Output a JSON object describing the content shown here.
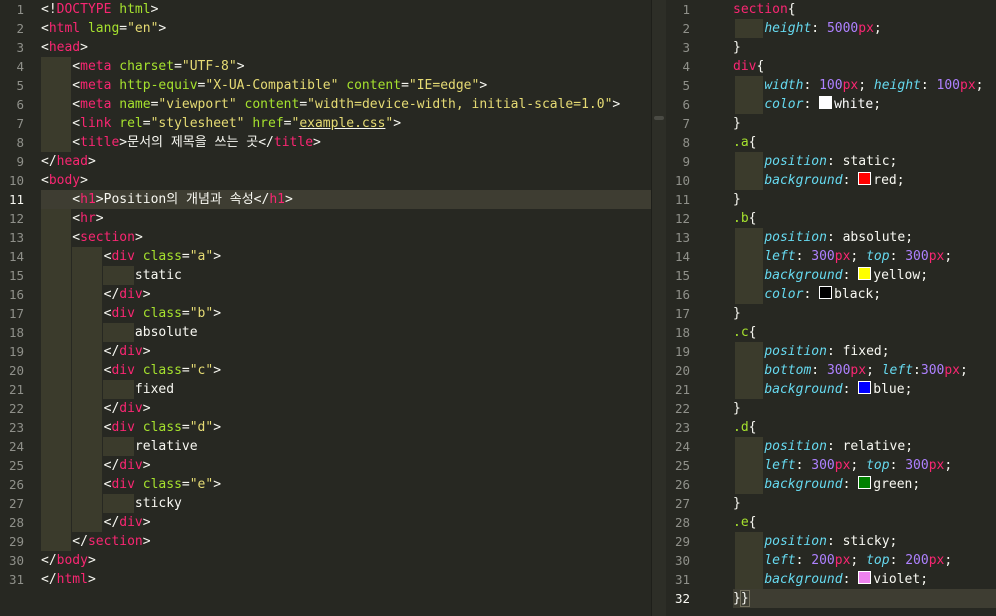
{
  "colors": {
    "tag": "#f92672",
    "attr": "#a6e22e",
    "string": "#e6db74",
    "text": "#f8f8f2",
    "prop": "#66d9ef",
    "number": "#ae81ff",
    "punct": "#f8f8f2"
  },
  "left": {
    "lines": [
      [
        [
          "<!",
          "#f8f8f2"
        ],
        [
          "DOCTYPE",
          "#f92672"
        ],
        [
          " html",
          "#a6e22e"
        ],
        [
          ">",
          "#f8f8f2"
        ]
      ],
      [
        [
          "<",
          "#f8f8f2"
        ],
        [
          "html",
          "#f92672"
        ],
        [
          " lang",
          "#a6e22e"
        ],
        [
          "=",
          "#f8f8f2"
        ],
        [
          "\"en\"",
          "#e6db74"
        ],
        [
          ">",
          "#f8f8f2"
        ]
      ],
      [
        [
          "<",
          "#f8f8f2"
        ],
        [
          "head",
          "#f92672"
        ],
        [
          ">",
          "#f8f8f2"
        ]
      ],
      [
        [
          "    <",
          "#f8f8f2"
        ],
        [
          "meta",
          "#f92672"
        ],
        [
          " charset",
          "#a6e22e"
        ],
        [
          "=",
          "#f8f8f2"
        ],
        [
          "\"UTF-8\"",
          "#e6db74"
        ],
        [
          ">",
          "#f8f8f2"
        ]
      ],
      [
        [
          "    <",
          "#f8f8f2"
        ],
        [
          "meta",
          "#f92672"
        ],
        [
          " http-equiv",
          "#a6e22e"
        ],
        [
          "=",
          "#f8f8f2"
        ],
        [
          "\"X-UA-Compatible\"",
          "#e6db74"
        ],
        [
          " content",
          "#a6e22e"
        ],
        [
          "=",
          "#f8f8f2"
        ],
        [
          "\"IE=edge\"",
          "#e6db74"
        ],
        [
          ">",
          "#f8f8f2"
        ]
      ],
      [
        [
          "    <",
          "#f8f8f2"
        ],
        [
          "meta",
          "#f92672"
        ],
        [
          " name",
          "#a6e22e"
        ],
        [
          "=",
          "#f8f8f2"
        ],
        [
          "\"viewport\"",
          "#e6db74"
        ],
        [
          " content",
          "#a6e22e"
        ],
        [
          "=",
          "#f8f8f2"
        ],
        [
          "\"width=device-width, initial-scale=1.0\"",
          "#e6db74"
        ],
        [
          ">",
          "#f8f8f2"
        ]
      ],
      [
        [
          "    <",
          "#f8f8f2"
        ],
        [
          "link",
          "#f92672"
        ],
        [
          " rel",
          "#a6e22e"
        ],
        [
          "=",
          "#f8f8f2"
        ],
        [
          "\"stylesheet\"",
          "#e6db74"
        ],
        [
          " href",
          "#a6e22e"
        ],
        [
          "=",
          "#f8f8f2"
        ],
        [
          "\"",
          "#e6db74"
        ],
        [
          "example.css",
          "#e6db74",
          "u"
        ],
        [
          "\"",
          "#e6db74"
        ],
        [
          ">",
          "#f8f8f2"
        ]
      ],
      [
        [
          "    <",
          "#f8f8f2"
        ],
        [
          "title",
          "#f92672"
        ],
        [
          ">문서의 제목을 쓰는 곳</",
          "#f8f8f2"
        ],
        [
          "title",
          "#f92672"
        ],
        [
          ">",
          "#f8f8f2"
        ]
      ],
      [
        [
          "</",
          "#f8f8f2"
        ],
        [
          "head",
          "#f92672"
        ],
        [
          ">",
          "#f8f8f2"
        ]
      ],
      [
        [
          "<",
          "#f8f8f2"
        ],
        [
          "body",
          "#f92672"
        ],
        [
          ">",
          "#f8f8f2"
        ]
      ],
      [
        [
          "    <",
          "#f8f8f2"
        ],
        [
          "h1",
          "#f92672"
        ],
        [
          ">Position의 개념과 속성</",
          "#f8f8f2"
        ],
        [
          "h1",
          "#f92672"
        ],
        [
          ">",
          "#f8f8f2"
        ]
      ],
      [
        [
          "    <",
          "#f8f8f2"
        ],
        [
          "hr",
          "#f92672"
        ],
        [
          ">",
          "#f8f8f2"
        ]
      ],
      [
        [
          "    <",
          "#f8f8f2"
        ],
        [
          "section",
          "#f92672"
        ],
        [
          ">",
          "#f8f8f2"
        ]
      ],
      [
        [
          "        <",
          "#f8f8f2"
        ],
        [
          "div",
          "#f92672"
        ],
        [
          " class",
          "#a6e22e"
        ],
        [
          "=",
          "#f8f8f2"
        ],
        [
          "\"a\"",
          "#e6db74"
        ],
        [
          ">",
          "#f8f8f2"
        ]
      ],
      [
        [
          "            static",
          "#f8f8f2"
        ]
      ],
      [
        [
          "        </",
          "#f8f8f2"
        ],
        [
          "div",
          "#f92672"
        ],
        [
          ">",
          "#f8f8f2"
        ]
      ],
      [
        [
          "        <",
          "#f8f8f2"
        ],
        [
          "div",
          "#f92672"
        ],
        [
          " class",
          "#a6e22e"
        ],
        [
          "=",
          "#f8f8f2"
        ],
        [
          "\"b\"",
          "#e6db74"
        ],
        [
          ">",
          "#f8f8f2"
        ]
      ],
      [
        [
          "            absolute",
          "#f8f8f2"
        ]
      ],
      [
        [
          "        </",
          "#f8f8f2"
        ],
        [
          "div",
          "#f92672"
        ],
        [
          ">",
          "#f8f8f2"
        ]
      ],
      [
        [
          "        <",
          "#f8f8f2"
        ],
        [
          "div",
          "#f92672"
        ],
        [
          " class",
          "#a6e22e"
        ],
        [
          "=",
          "#f8f8f2"
        ],
        [
          "\"c\"",
          "#e6db74"
        ],
        [
          ">",
          "#f8f8f2"
        ]
      ],
      [
        [
          "            fixed",
          "#f8f8f2"
        ]
      ],
      [
        [
          "        </",
          "#f8f8f2"
        ],
        [
          "div",
          "#f92672"
        ],
        [
          ">",
          "#f8f8f2"
        ]
      ],
      [
        [
          "        <",
          "#f8f8f2"
        ],
        [
          "div",
          "#f92672"
        ],
        [
          " class",
          "#a6e22e"
        ],
        [
          "=",
          "#f8f8f2"
        ],
        [
          "\"d\"",
          "#e6db74"
        ],
        [
          ">",
          "#f8f8f2"
        ]
      ],
      [
        [
          "            relative",
          "#f8f8f2"
        ]
      ],
      [
        [
          "        </",
          "#f8f8f2"
        ],
        [
          "div",
          "#f92672"
        ],
        [
          ">",
          "#f8f8f2"
        ]
      ],
      [
        [
          "        <",
          "#f8f8f2"
        ],
        [
          "div",
          "#f92672"
        ],
        [
          " class",
          "#a6e22e"
        ],
        [
          "=",
          "#f8f8f2"
        ],
        [
          "\"e\"",
          "#e6db74"
        ],
        [
          ">",
          "#f8f8f2"
        ]
      ],
      [
        [
          "            sticky",
          "#f8f8f2"
        ]
      ],
      [
        [
          "        </",
          "#f8f8f2"
        ],
        [
          "div",
          "#f92672"
        ],
        [
          ">",
          "#f8f8f2"
        ]
      ],
      [
        [
          "    </",
          "#f8f8f2"
        ],
        [
          "section",
          "#f92672"
        ],
        [
          ">",
          "#f8f8f2"
        ]
      ],
      [
        [
          "</",
          "#f8f8f2"
        ],
        [
          "body",
          "#f92672"
        ],
        [
          ">",
          "#f8f8f2"
        ]
      ],
      [
        [
          "</",
          "#f8f8f2"
        ],
        [
          "html",
          "#f92672"
        ],
        [
          ">",
          "#f8f8f2"
        ]
      ]
    ],
    "active_line": 11,
    "guides": [
      [
        4,
        1
      ],
      [
        5,
        1
      ],
      [
        6,
        1
      ],
      [
        7,
        1
      ],
      [
        8,
        1
      ],
      [
        11,
        1
      ],
      [
        12,
        1
      ],
      [
        13,
        1
      ],
      [
        14,
        1
      ],
      [
        14,
        2
      ],
      [
        15,
        1
      ],
      [
        15,
        2
      ],
      [
        15,
        3
      ],
      [
        16,
        1
      ],
      [
        16,
        2
      ],
      [
        17,
        1
      ],
      [
        17,
        2
      ],
      [
        18,
        1
      ],
      [
        18,
        2
      ],
      [
        18,
        3
      ],
      [
        19,
        1
      ],
      [
        19,
        2
      ],
      [
        20,
        1
      ],
      [
        20,
        2
      ],
      [
        21,
        1
      ],
      [
        21,
        2
      ],
      [
        21,
        3
      ],
      [
        22,
        1
      ],
      [
        22,
        2
      ],
      [
        23,
        1
      ],
      [
        23,
        2
      ],
      [
        24,
        1
      ],
      [
        24,
        2
      ],
      [
        24,
        3
      ],
      [
        25,
        1
      ],
      [
        25,
        2
      ],
      [
        26,
        1
      ],
      [
        26,
        2
      ],
      [
        27,
        1
      ],
      [
        27,
        2
      ],
      [
        27,
        3
      ],
      [
        28,
        1
      ],
      [
        28,
        2
      ],
      [
        29,
        1
      ]
    ]
  },
  "right": {
    "lines": [
      [
        [
          "section",
          "#f92672"
        ],
        [
          "{",
          "#f8f8f2"
        ]
      ],
      [
        [
          "    ",
          "#f8f8f2"
        ],
        [
          "height",
          "#66d9ef",
          "i"
        ],
        [
          ": ",
          "#f8f8f2"
        ],
        [
          "5000",
          "#ae81ff"
        ],
        [
          "px",
          "#f92672"
        ],
        [
          ";",
          "#f8f8f2"
        ]
      ],
      [
        [
          "}",
          "#f8f8f2"
        ]
      ],
      [
        [
          "div",
          "#f92672"
        ],
        [
          "{",
          "#f8f8f2"
        ]
      ],
      [
        [
          "    ",
          "#f8f8f2"
        ],
        [
          "width",
          "#66d9ef",
          "i"
        ],
        [
          ": ",
          "#f8f8f2"
        ],
        [
          "100",
          "#ae81ff"
        ],
        [
          "px",
          "#f92672"
        ],
        [
          "; ",
          "#f8f8f2"
        ],
        [
          "height",
          "#66d9ef",
          "i"
        ],
        [
          ": ",
          "#f8f8f2"
        ],
        [
          "100",
          "#ae81ff"
        ],
        [
          "px",
          "#f92672"
        ],
        [
          ";",
          "#f8f8f2"
        ]
      ],
      [
        [
          "    ",
          "#f8f8f2"
        ],
        [
          "color",
          "#66d9ef",
          "i"
        ],
        [
          ": ",
          "#f8f8f2"
        ],
        [
          "■white",
          "#ffffff",
          "sw:#ffffff"
        ],
        [
          ";",
          "#f8f8f2"
        ]
      ],
      [
        [
          "}",
          "#f8f8f2"
        ]
      ],
      [
        [
          ".a",
          "#a6e22e"
        ],
        [
          "{",
          "#f8f8f2"
        ]
      ],
      [
        [
          "    ",
          "#f8f8f2"
        ],
        [
          "position",
          "#66d9ef",
          "i"
        ],
        [
          ": static;",
          "#f8f8f2"
        ]
      ],
      [
        [
          "    ",
          "#f8f8f2"
        ],
        [
          "background",
          "#66d9ef",
          "i"
        ],
        [
          ": ",
          "#f8f8f2"
        ],
        [
          "■red",
          "#f8f8f2",
          "sw:#ff0000"
        ],
        [
          ";",
          "#f8f8f2"
        ]
      ],
      [
        [
          "}",
          "#f8f8f2"
        ]
      ],
      [
        [
          ".b",
          "#a6e22e"
        ],
        [
          "{",
          "#f8f8f2"
        ]
      ],
      [
        [
          "    ",
          "#f8f8f2"
        ],
        [
          "position",
          "#66d9ef",
          "i"
        ],
        [
          ": absolute;",
          "#f8f8f2"
        ]
      ],
      [
        [
          "    ",
          "#f8f8f2"
        ],
        [
          "left",
          "#66d9ef",
          "i"
        ],
        [
          ": ",
          "#f8f8f2"
        ],
        [
          "300",
          "#ae81ff"
        ],
        [
          "px",
          "#f92672"
        ],
        [
          "; ",
          "#f8f8f2"
        ],
        [
          "top",
          "#66d9ef",
          "i"
        ],
        [
          ": ",
          "#f8f8f2"
        ],
        [
          "300",
          "#ae81ff"
        ],
        [
          "px",
          "#f92672"
        ],
        [
          ";",
          "#f8f8f2"
        ]
      ],
      [
        [
          "    ",
          "#f8f8f2"
        ],
        [
          "background",
          "#66d9ef",
          "i"
        ],
        [
          ": ",
          "#f8f8f2"
        ],
        [
          "■yellow",
          "#f8f8f2",
          "sw:#ffff00"
        ],
        [
          ";",
          "#f8f8f2"
        ]
      ],
      [
        [
          "    ",
          "#f8f8f2"
        ],
        [
          "color",
          "#66d9ef",
          "i"
        ],
        [
          ": ",
          "#f8f8f2"
        ],
        [
          "■black",
          "#f8f8f2",
          "sw:#000000"
        ],
        [
          ";",
          "#f8f8f2"
        ]
      ],
      [
        [
          "}",
          "#f8f8f2"
        ]
      ],
      [
        [
          ".c",
          "#a6e22e"
        ],
        [
          "{",
          "#f8f8f2"
        ]
      ],
      [
        [
          "    ",
          "#f8f8f2"
        ],
        [
          "position",
          "#66d9ef",
          "i"
        ],
        [
          ": fixed;",
          "#f8f8f2"
        ]
      ],
      [
        [
          "    ",
          "#f8f8f2"
        ],
        [
          "bottom",
          "#66d9ef",
          "i"
        ],
        [
          ": ",
          "#f8f8f2"
        ],
        [
          "300",
          "#ae81ff"
        ],
        [
          "px",
          "#f92672"
        ],
        [
          "; ",
          "#f8f8f2"
        ],
        [
          "left",
          "#66d9ef",
          "i"
        ],
        [
          ":",
          "#f8f8f2"
        ],
        [
          "300",
          "#ae81ff"
        ],
        [
          "px",
          "#f92672"
        ],
        [
          ";",
          "#f8f8f2"
        ]
      ],
      [
        [
          "    ",
          "#f8f8f2"
        ],
        [
          "background",
          "#66d9ef",
          "i"
        ],
        [
          ": ",
          "#f8f8f2"
        ],
        [
          "■blue",
          "#f8f8f2",
          "sw:#0000ff"
        ],
        [
          ";",
          "#f8f8f2"
        ]
      ],
      [
        [
          "}",
          "#f8f8f2"
        ]
      ],
      [
        [
          ".d",
          "#a6e22e"
        ],
        [
          "{",
          "#f8f8f2"
        ]
      ],
      [
        [
          "    ",
          "#f8f8f2"
        ],
        [
          "position",
          "#66d9ef",
          "i"
        ],
        [
          ": relative;",
          "#f8f8f2"
        ]
      ],
      [
        [
          "    ",
          "#f8f8f2"
        ],
        [
          "left",
          "#66d9ef",
          "i"
        ],
        [
          ": ",
          "#f8f8f2"
        ],
        [
          "300",
          "#ae81ff"
        ],
        [
          "px",
          "#f92672"
        ],
        [
          "; ",
          "#f8f8f2"
        ],
        [
          "top",
          "#66d9ef",
          "i"
        ],
        [
          ": ",
          "#f8f8f2"
        ],
        [
          "300",
          "#ae81ff"
        ],
        [
          "px",
          "#f92672"
        ],
        [
          ";",
          "#f8f8f2"
        ]
      ],
      [
        [
          "    ",
          "#f8f8f2"
        ],
        [
          "background",
          "#66d9ef",
          "i"
        ],
        [
          ": ",
          "#f8f8f2"
        ],
        [
          "■green",
          "#f8f8f2",
          "sw:#008000"
        ],
        [
          ";",
          "#f8f8f2"
        ]
      ],
      [
        [
          "}",
          "#f8f8f2"
        ]
      ],
      [
        [
          ".e",
          "#a6e22e"
        ],
        [
          "{",
          "#f8f8f2"
        ]
      ],
      [
        [
          "    ",
          "#f8f8f2"
        ],
        [
          "position",
          "#66d9ef",
          "i"
        ],
        [
          ": sticky;",
          "#f8f8f2"
        ]
      ],
      [
        [
          "    ",
          "#f8f8f2"
        ],
        [
          "left",
          "#66d9ef",
          "i"
        ],
        [
          ": ",
          "#f8f8f2"
        ],
        [
          "200",
          "#ae81ff"
        ],
        [
          "px",
          "#f92672"
        ],
        [
          "; ",
          "#f8f8f2"
        ],
        [
          "top",
          "#66d9ef",
          "i"
        ],
        [
          ": ",
          "#f8f8f2"
        ],
        [
          "200",
          "#ae81ff"
        ],
        [
          "px",
          "#f92672"
        ],
        [
          ";",
          "#f8f8f2"
        ]
      ],
      [
        [
          "    ",
          "#f8f8f2"
        ],
        [
          "background",
          "#66d9ef",
          "i"
        ],
        [
          ": ",
          "#f8f8f2"
        ],
        [
          "■violet",
          "#f8f8f2",
          "sw:#ee82ee"
        ],
        [
          ";",
          "#f8f8f2"
        ]
      ],
      [
        [
          "}",
          "#f8f8f2"
        ]
      ]
    ],
    "active_line": 32,
    "guide_lines": [
      2,
      5,
      6,
      9,
      10,
      13,
      14,
      15,
      16,
      19,
      20,
      21,
      24,
      25,
      26,
      29,
      30,
      31
    ]
  }
}
